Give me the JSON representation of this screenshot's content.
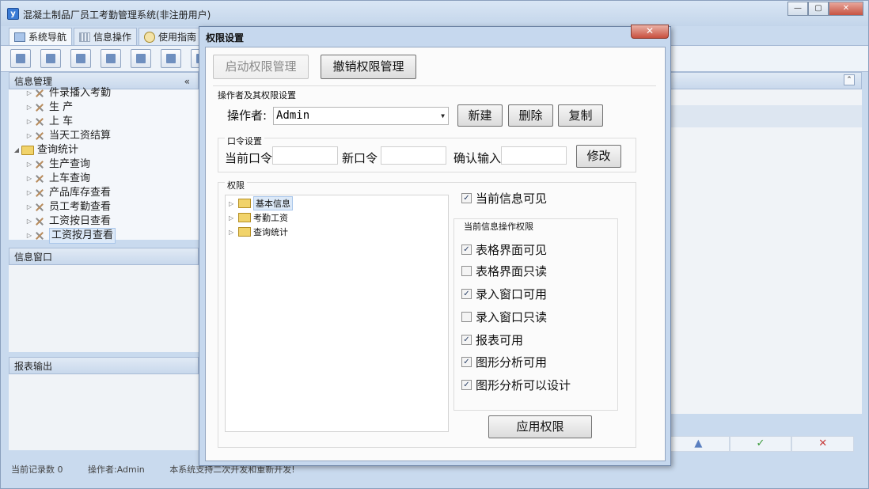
{
  "main_window": {
    "title": "混凝土制品厂员工考勤管理系统(非注册用户)",
    "app_icon_glyph": "y"
  },
  "nav_tabs": [
    {
      "label": "系统导航"
    },
    {
      "label": "信息操作"
    },
    {
      "label": "使用指南"
    }
  ],
  "left_panel": {
    "info_mgmt_title": "信息管理",
    "collapse_glyph": "«",
    "tree": [
      {
        "label": "件录播入考勤",
        "indent": 1
      },
      {
        "label": "生 产",
        "indent": 1
      },
      {
        "label": "上 车",
        "indent": 1
      },
      {
        "label": "当天工资结算",
        "indent": 1
      },
      {
        "label": "查询统计",
        "indent": 0
      },
      {
        "label": "生产查询",
        "indent": 1
      },
      {
        "label": "上车查询",
        "indent": 1
      },
      {
        "label": "产品库存查看",
        "indent": 1
      },
      {
        "label": "员工考勤查看",
        "indent": 1
      },
      {
        "label": "工资按日查看",
        "indent": 1
      },
      {
        "label": "工资按月查看",
        "indent": 1
      }
    ],
    "info_window_title": "信息窗口",
    "report_output_title": "报表输出"
  },
  "right_panel": {
    "collapse_glyph": "⌃",
    "strip": [
      "▲",
      "✓",
      "✕"
    ]
  },
  "status_bar": {
    "record_count": "当前记录数 0",
    "operator": "操作者:Admin",
    "notice": "本系统支持二次开发和重新开发!"
  },
  "dialog": {
    "title": "权限设置",
    "close_glyph": "✕",
    "enable_btn": "启动权限管理",
    "revoke_btn": "撤销权限管理",
    "operator_section": "操作者及其权限设置",
    "operator_label": "操作者:",
    "operator_value": "Admin",
    "new_btn": "新建",
    "delete_btn": "删除",
    "copy_btn": "复制",
    "password_section": "口令设置",
    "current_pw_label": "当前口令",
    "new_pw_label": "新口令",
    "confirm_pw_label": "确认输入",
    "modify_btn": "修改",
    "perm_section": "权限",
    "perm_tree": [
      "基本信息",
      "考勤工资",
      "查询统计"
    ],
    "current_visible": "当前信息可见",
    "ops_section": "当前信息操作权限",
    "ops": [
      {
        "label": "表格界面可见",
        "checked": true
      },
      {
        "label": "表格界面只读",
        "checked": false
      },
      {
        "label": "录入窗口可用",
        "checked": true
      },
      {
        "label": "录入窗口只读",
        "checked": false
      },
      {
        "label": "报表可用",
        "checked": true
      },
      {
        "label": "图形分析可用",
        "checked": true
      },
      {
        "label": "图形分析可以设计",
        "checked": true
      }
    ],
    "apply_btn": "应用权限",
    "check_glyph": "✓"
  }
}
